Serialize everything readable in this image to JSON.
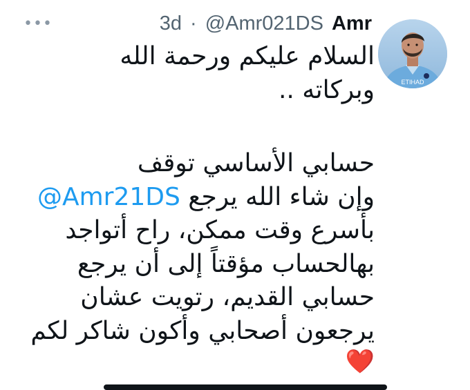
{
  "header": {
    "time": "3d",
    "separator": "·",
    "handle": "@Amr021DS",
    "name": "Amr",
    "more_icon": "ellipsis-icon"
  },
  "avatar": {
    "icon": "profile-photo",
    "jersey_text": "ETIHAD",
    "colors": {
      "sky": "#9dc4e8",
      "jersey": "#6cabdd",
      "hair": "#2b2420",
      "skin": "#c69074"
    }
  },
  "tweet": {
    "greeting_line1": "السلام عليكم ورحمة الله",
    "greeting_line2": "وبركاته ..",
    "line1": "حسابي الأساسي توقف",
    "line2_mention": "@Amr21DS",
    "line2_text": "وإن شاء الله يرجع",
    "line3": "بأسرع وقت ممكن، راح أتواجد",
    "line4": "بهالحساب مؤقتاً إلى أن يرجع",
    "line5": "حسابي القديم، رتويت عشان",
    "line6": "يرجعون أصحابي وأكون شاكر لكم",
    "heart": "❤️"
  },
  "colors": {
    "text": "#0f1419",
    "secondary": "#536471",
    "link": "#1d9bf0",
    "heart": "#e0245e"
  }
}
